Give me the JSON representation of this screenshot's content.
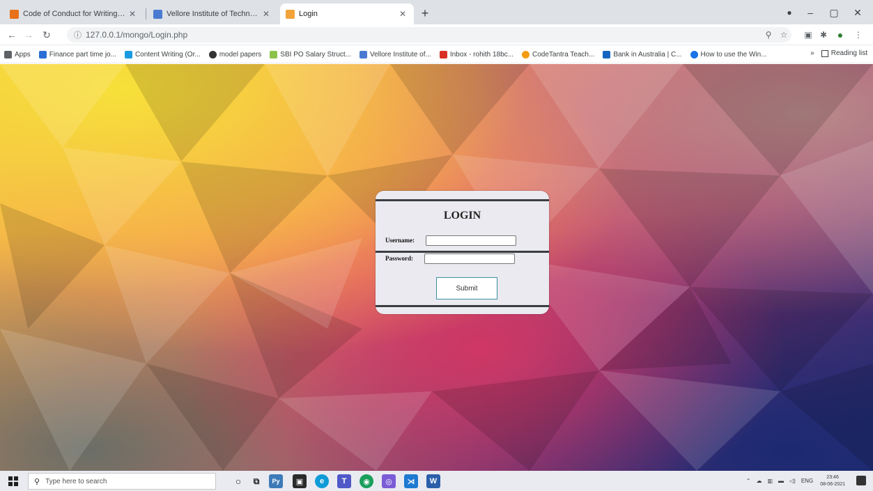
{
  "browser": {
    "tabs": [
      {
        "title": "Code of Conduct for Writing M...",
        "favicon_color": "#e8711a",
        "active": false
      },
      {
        "title": "Vellore Institute of Technology |...",
        "favicon_color": "#4a7bd0",
        "active": false
      },
      {
        "title": "Login",
        "favicon_color": "#f2a33a",
        "active": true
      }
    ],
    "new_tab_label": "+",
    "window_controls": {
      "minimize": "–",
      "maximize": "▢",
      "close": "✕"
    },
    "url": "127.0.0.1/mongo/Login.php",
    "bookmarks": [
      {
        "label": "Apps",
        "color": "#5f6368"
      },
      {
        "label": "Finance part time jo...",
        "color": "#2a6fd6"
      },
      {
        "label": "Content Writing (Or...",
        "color": "#1a9be0"
      },
      {
        "label": "model papers",
        "color": "#333333"
      },
      {
        "label": "SBI PO Salary Struct...",
        "color": "#8bc34a"
      },
      {
        "label": "Vellore Institute of...",
        "color": "#4a7bd0"
      },
      {
        "label": "Inbox - rohith 18bc...",
        "color": "#d93025"
      },
      {
        "label": "CodeTantra Teach...",
        "color": "#f39c12"
      },
      {
        "label": "Bank in Australia | C...",
        "color": "#1565c0"
      },
      {
        "label": "How to use the Win...",
        "color": "#1a73e8"
      }
    ],
    "reading_list": "Reading list"
  },
  "login": {
    "title": "LOGIN",
    "username_label": "Username:",
    "password_label": "Password:",
    "username_value": "",
    "password_value": "",
    "submit_label": "Submit"
  },
  "taskbar": {
    "search_placeholder": "Type here to search",
    "apps": [
      {
        "name": "cortana-icon",
        "color": "#1f1f1f",
        "glyph": "○"
      },
      {
        "name": "task-view-icon",
        "color": "#1f1f1f",
        "glyph": "⧉"
      },
      {
        "name": "python-icon",
        "color": "#3d7ab8",
        "glyph": "Py"
      },
      {
        "name": "store-icon",
        "color": "#2b2b2b",
        "glyph": "▣"
      },
      {
        "name": "edge-icon",
        "color": "#0f9bd7",
        "glyph": "e"
      },
      {
        "name": "teams-icon",
        "color": "#5058c7",
        "glyph": "T"
      },
      {
        "name": "chrome-icon",
        "color": "#1a9e5c",
        "glyph": "◉"
      },
      {
        "name": "chrome-alt-icon",
        "color": "#7b5cd6",
        "glyph": "◎"
      },
      {
        "name": "vscode-icon",
        "color": "#1e7ad1",
        "glyph": "⋊"
      },
      {
        "name": "word-icon",
        "color": "#2b5faa",
        "glyph": "W"
      }
    ],
    "language": "ENG",
    "time": "23:46",
    "date": "08-06-2021"
  }
}
